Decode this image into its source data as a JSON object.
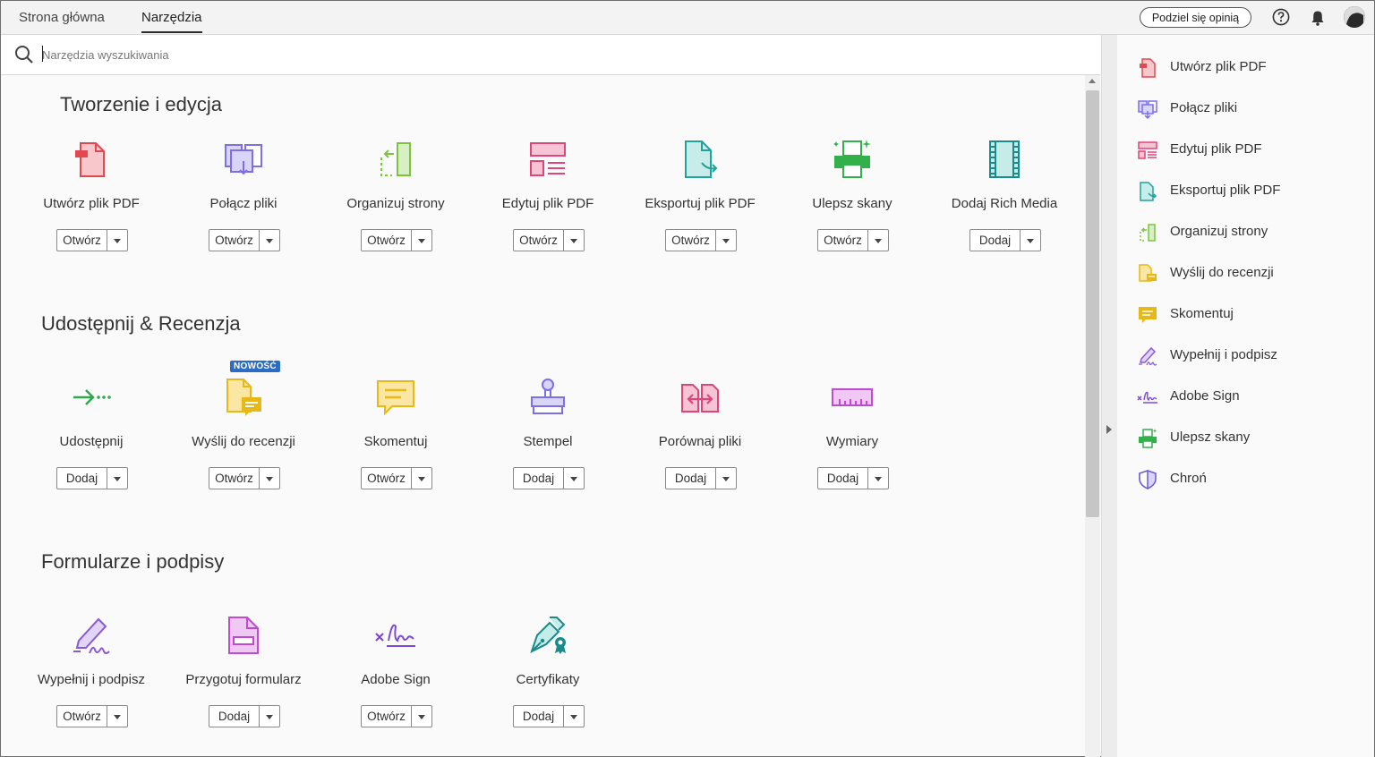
{
  "topbar": {
    "tabs": [
      {
        "label": "Strona główna"
      },
      {
        "label": "Narzędzia"
      }
    ],
    "active_tab": "Narzędzia",
    "share_label": "Podziel się opinią"
  },
  "search": {
    "placeholder": "Narzędzia wyszukiwania",
    "value": ""
  },
  "sections": [
    {
      "title": "Tworzenie i edycja",
      "tools": [
        {
          "label": "Utwórz plik PDF",
          "button": "Otwórz",
          "icon": "create-pdf-icon",
          "color": "#e34850"
        },
        {
          "label": "Połącz pliki",
          "button": "Otwórz",
          "icon": "combine-files-icon",
          "color": "#7c6fe8"
        },
        {
          "label": "Organizuj strony",
          "button": "Otwórz",
          "icon": "organize-pages-icon",
          "color": "#7cc33f"
        },
        {
          "label": "Edytuj plik PDF",
          "button": "Otwórz",
          "icon": "edit-pdf-icon",
          "color": "#e0457a"
        },
        {
          "label": "Eksportuj plik PDF",
          "button": "Otwórz",
          "icon": "export-pdf-icon",
          "color": "#1fa39a"
        },
        {
          "label": "Ulepsz skany",
          "button": "Otwórz",
          "icon": "enhance-scans-icon",
          "color": "#33b04a"
        },
        {
          "label": "Dodaj Rich Media",
          "button": "Dodaj",
          "icon": "rich-media-icon",
          "color": "#1b8a8a"
        }
      ]
    },
    {
      "title": "Udostępnij & Recenzja",
      "tools": [
        {
          "label": "Udostępnij",
          "button": "Dodaj",
          "icon": "share-icon",
          "color": "#2fa84f"
        },
        {
          "label": "Wyślij do recenzji",
          "button": "Otwórz",
          "icon": "send-review-icon",
          "color": "#e8b818",
          "badge": "NOWOŚĆ"
        },
        {
          "label": "Skomentuj",
          "button": "Otwórz",
          "icon": "comment-icon",
          "color": "#e8b818"
        },
        {
          "label": "Stempel",
          "button": "Dodaj",
          "icon": "stamp-icon",
          "color": "#7c6fe8"
        },
        {
          "label": "Porównaj pliki",
          "button": "Dodaj",
          "icon": "compare-files-icon",
          "color": "#e0457a"
        },
        {
          "label": "Wymiary",
          "button": "Dodaj",
          "icon": "measure-icon",
          "color": "#c04bd0"
        }
      ]
    },
    {
      "title": "Formularze i podpisy",
      "tools": [
        {
          "label": "Wypełnij i podpisz",
          "button": "Otwórz",
          "icon": "fill-sign-icon",
          "color": "#8a5ad6"
        },
        {
          "label": "Przygotuj formularz",
          "button": "Dodaj",
          "icon": "prepare-form-icon",
          "color": "#c04bd0"
        },
        {
          "label": "Adobe Sign",
          "button": "Otwórz",
          "icon": "adobe-sign-icon",
          "color": "#7c4ad6"
        },
        {
          "label": "Certyfikaty",
          "button": "Dodaj",
          "icon": "certificates-icon",
          "color": "#1b8a8a"
        }
      ]
    }
  ],
  "right_panel": {
    "items": [
      {
        "label": "Utwórz plik PDF",
        "icon": "create-pdf-icon"
      },
      {
        "label": "Połącz pliki",
        "icon": "combine-files-icon"
      },
      {
        "label": "Edytuj plik PDF",
        "icon": "edit-pdf-icon"
      },
      {
        "label": "Eksportuj plik PDF",
        "icon": "export-pdf-icon"
      },
      {
        "label": "Organizuj strony",
        "icon": "organize-pages-icon"
      },
      {
        "label": "Wyślij do recenzji",
        "icon": "send-review-icon"
      },
      {
        "label": "Skomentuj",
        "icon": "comment-icon"
      },
      {
        "label": "Wypełnij i podpisz",
        "icon": "fill-sign-icon"
      },
      {
        "label": "Adobe Sign",
        "icon": "adobe-sign-icon"
      },
      {
        "label": "Ulepsz skany",
        "icon": "enhance-scans-icon"
      },
      {
        "label": "Chroń",
        "icon": "protect-icon"
      }
    ]
  }
}
